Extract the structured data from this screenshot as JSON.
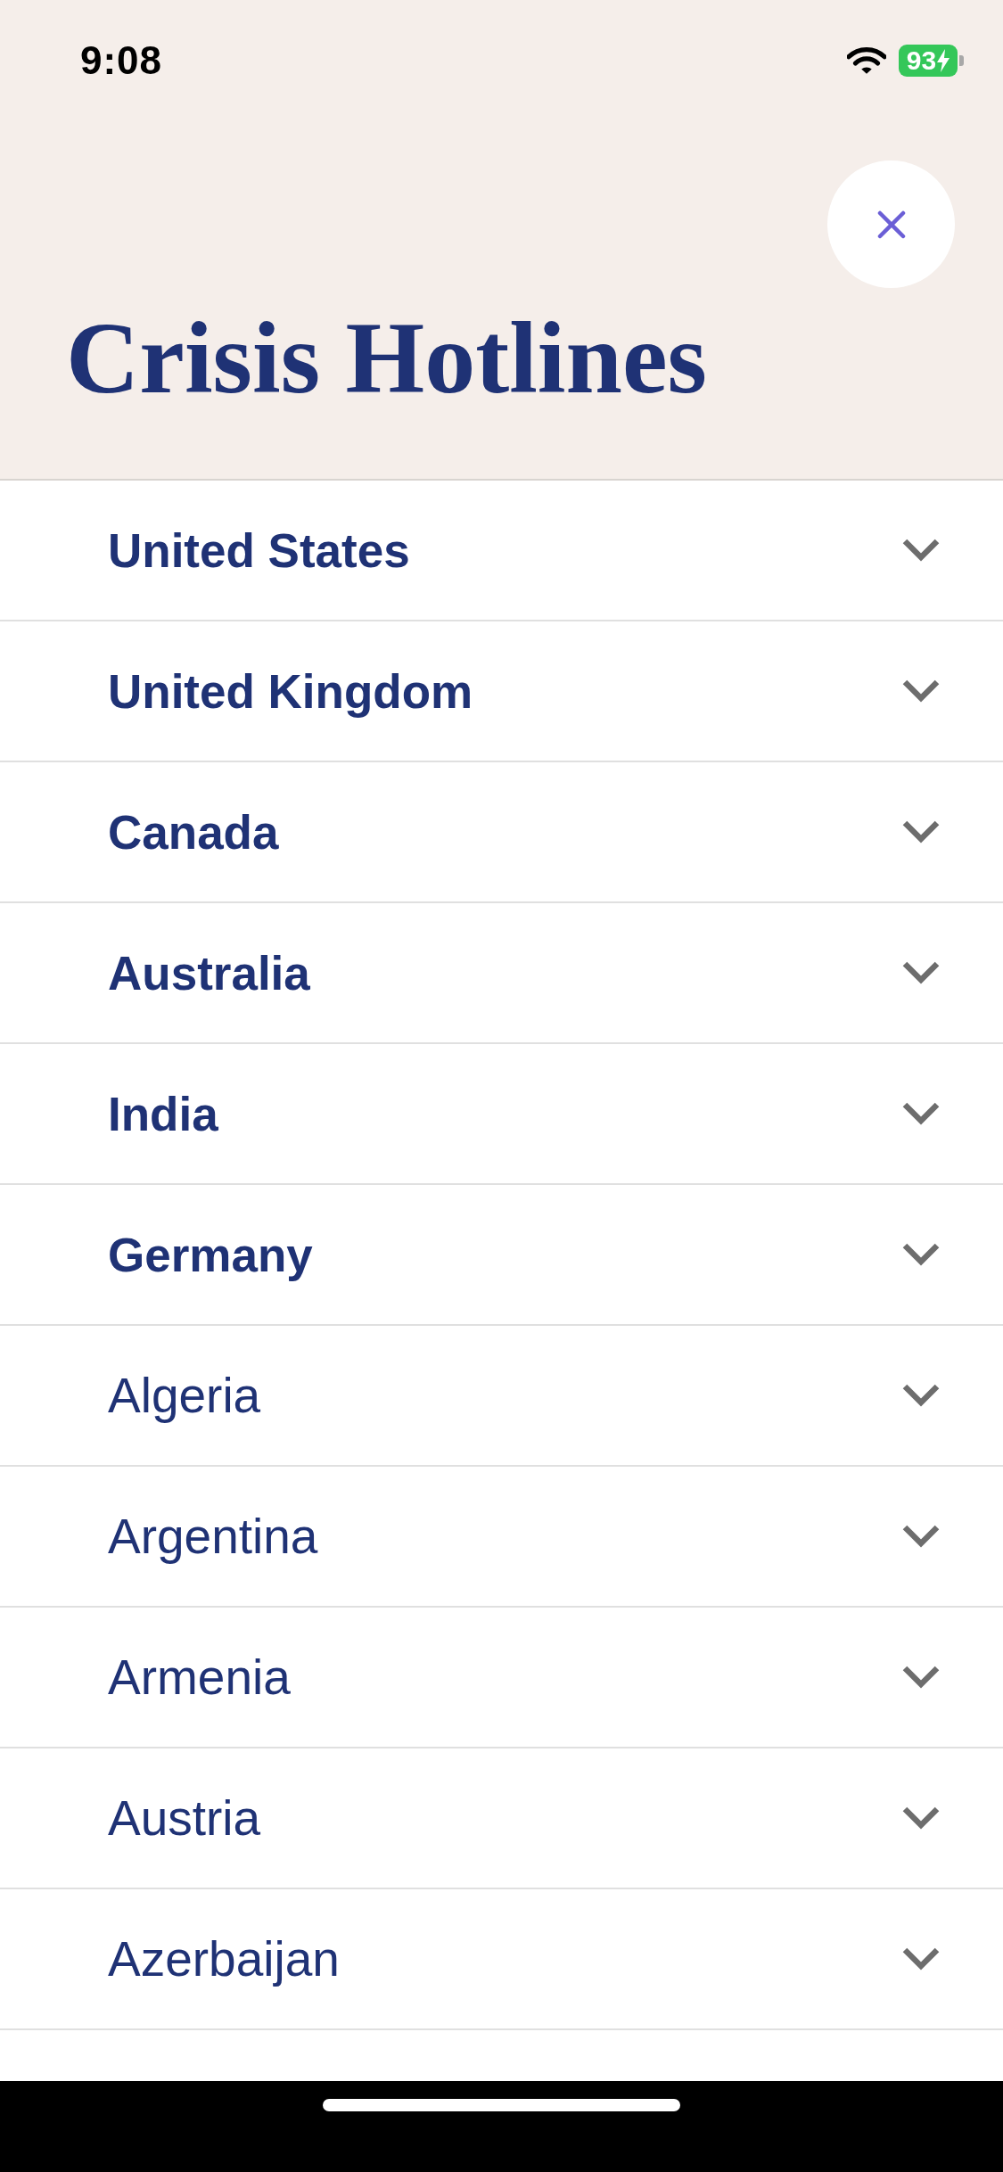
{
  "status_bar": {
    "time": "9:08",
    "battery": "93",
    "charging": true
  },
  "header": {
    "title": "Crisis Hotlines"
  },
  "countries": [
    {
      "name": "United States",
      "featured": true,
      "expanded": false
    },
    {
      "name": "United Kingdom",
      "featured": true,
      "expanded": false
    },
    {
      "name": "Canada",
      "featured": true,
      "expanded": false
    },
    {
      "name": "Australia",
      "featured": true,
      "expanded": false
    },
    {
      "name": "India",
      "featured": true,
      "expanded": false
    },
    {
      "name": "Germany",
      "featured": true,
      "expanded": false
    },
    {
      "name": "Algeria",
      "featured": false,
      "expanded": false
    },
    {
      "name": "Argentina",
      "featured": false,
      "expanded": false
    },
    {
      "name": "Armenia",
      "featured": false,
      "expanded": false
    },
    {
      "name": "Austria",
      "featured": false,
      "expanded": false
    },
    {
      "name": "Azerbaijan",
      "featured": false,
      "expanded": false
    }
  ]
}
